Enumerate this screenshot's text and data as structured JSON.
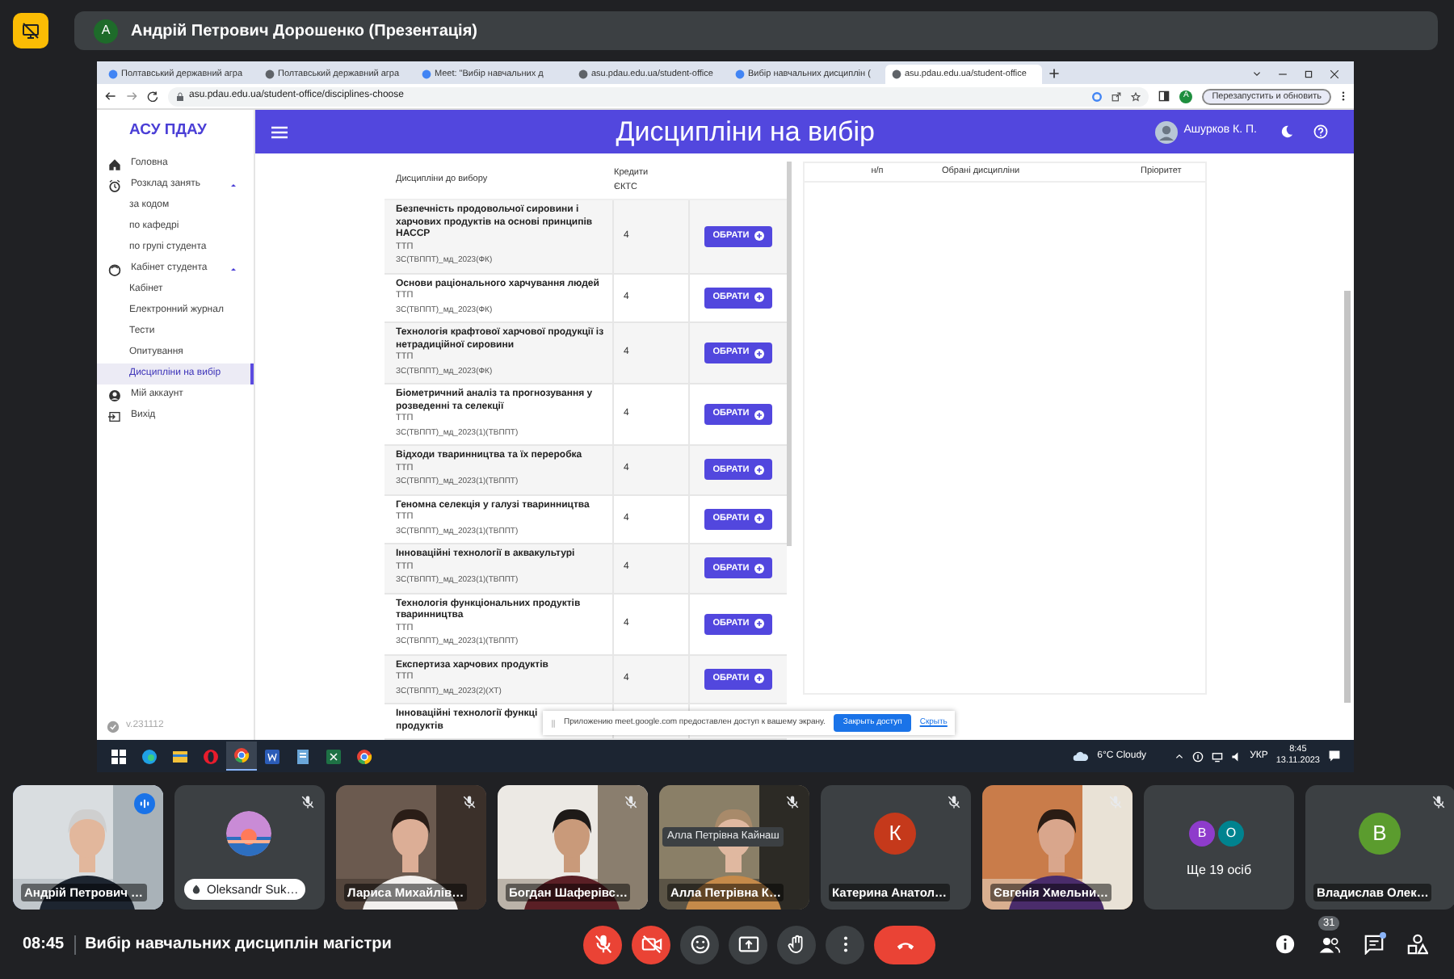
{
  "presenter_bar": {
    "avatar_letter": "A",
    "title": "Андрій Петрович Дорошенко (Презентація)"
  },
  "browser": {
    "tabs": [
      {
        "title": "Полтавський державний агра",
        "selected": false
      },
      {
        "title": "Полтавський державний агра",
        "selected": false
      },
      {
        "title": "Meet: \"Вибір навчальних д",
        "selected": false
      },
      {
        "title": "asu.pdau.edu.ua/student-office",
        "selected": false
      },
      {
        "title": "Вибір навчальних дисциплін (",
        "selected": false
      },
      {
        "title": "asu.pdau.edu.ua/student-office",
        "selected": true
      }
    ],
    "address": "asu.pdau.edu.ua/student-office/disciplines-choose",
    "profile_letter": "A",
    "relaunch_button": "Перезапустить и обновить"
  },
  "app": {
    "logo": "АСУ ПДАУ",
    "header_title": "Дисципліни на вибір",
    "user_name": "Ашурков К. П.",
    "sidebar": {
      "items": [
        {
          "label": "Головна",
          "selected": false
        },
        {
          "label": "Розклад занять",
          "selected": false,
          "expanded": true,
          "children": [
            {
              "label": "за кодом",
              "selected": false
            },
            {
              "label": "по кафедрі",
              "selected": false
            },
            {
              "label": "по групі студента",
              "selected": false
            }
          ]
        },
        {
          "label": "Кабінет студента",
          "selected": false,
          "expanded": true,
          "children": [
            {
              "label": "Кабінет",
              "selected": false
            },
            {
              "label": "Електронний журнал",
              "selected": false
            },
            {
              "label": "Тести",
              "selected": false
            },
            {
              "label": "Опитування",
              "selected": false
            },
            {
              "label": "Дисципліни на вибір",
              "selected": true
            }
          ]
        },
        {
          "label": "Мій аккаунт",
          "selected": false
        },
        {
          "label": "Вихід",
          "selected": false
        }
      ]
    },
    "version": "v.231112",
    "available_table": {
      "columns": [
        "Дисципліни до вибору",
        "Кредити ЄКТС"
      ],
      "rows": [
        {
          "title_lines": [
            "Безпечність продовольчої сировини і",
            "харчових продуктів на основі принципів",
            "НАССР"
          ],
          "department": "ТТП",
          "group": "ЗС(ТВППТ)_мд_2023(ФК)",
          "credits": "4",
          "button": "ОБРАТИ"
        },
        {
          "title_lines": [
            "Основи раціонального харчування людей"
          ],
          "department": "ТТП",
          "group": "ЗС(ТВППТ)_мд_2023(ФК)",
          "credits": "4",
          "button": "ОБРАТИ"
        },
        {
          "title_lines": [
            "Технологія крафтової харчової продукції із",
            "нетрадиційної сировини"
          ],
          "department": "ТТП",
          "group": "ЗС(ТВППТ)_мд_2023(ФК)",
          "credits": "4",
          "button": "ОБРАТИ"
        },
        {
          "title_lines": [
            "Біометричний аналіз та прогнозування у",
            "розведенні та селекції"
          ],
          "department": "ТТП",
          "group": "ЗС(ТВППТ)_мд_2023(1)(ТВППТ)",
          "credits": "4",
          "button": "ОБРАТИ"
        },
        {
          "title_lines": [
            "Відходи тваринництва та їх переробка"
          ],
          "department": "ТТП",
          "group": "ЗС(ТВППТ)_мд_2023(1)(ТВППТ)",
          "credits": "4",
          "button": "ОБРАТИ"
        },
        {
          "title_lines": [
            "Геномна селекція у галузі тваринництва"
          ],
          "department": "ТТП",
          "group": "ЗС(ТВППТ)_мд_2023(1)(ТВППТ)",
          "credits": "4",
          "button": "ОБРАТИ"
        },
        {
          "title_lines": [
            "Інноваційні технології в аквакультурі"
          ],
          "department": "ТТП",
          "group": "ЗС(ТВППТ)_мд_2023(1)(ТВППТ)",
          "credits": "4",
          "button": "ОБРАТИ"
        },
        {
          "title_lines": [
            "Технологія функціональних продуктів",
            "тваринництва"
          ],
          "department": "ТТП",
          "group": "ЗС(ТВППТ)_мд_2023(1)(ТВППТ)",
          "credits": "4",
          "button": "ОБРАТИ"
        },
        {
          "title_lines": [
            "Експертиза харчових продуктів"
          ],
          "department": "ТТП",
          "group": "ЗС(ТВППТ)_мд_2023(2)(ХТ)",
          "credits": "4",
          "button": "ОБРАТИ"
        },
        {
          "title_lines": [
            "Інноваційні технології функці",
            "продуктів"
          ]
        }
      ]
    },
    "chosen_table": {
      "columns": [
        "н/п",
        "Обрані дисципліни",
        "Пріоритет"
      ]
    },
    "share_notice": {
      "text": "Приложению meet.google.com предоставлен доступ к вашему экрану.",
      "stop_button": "Закрыть доступ",
      "hide_link": "Скрыть"
    }
  },
  "taskbar": {
    "apps": [
      {
        "kind": "start",
        "selected": false
      },
      {
        "kind": "edge",
        "selected": false
      },
      {
        "kind": "files",
        "selected": false
      },
      {
        "kind": "opera",
        "selected": false
      },
      {
        "kind": "chrome",
        "selected": true
      },
      {
        "kind": "word",
        "selected": false
      },
      {
        "kind": "tool",
        "selected": false
      },
      {
        "kind": "excel",
        "selected": false
      },
      {
        "kind": "chrome",
        "selected": false
      }
    ],
    "weather": "6°C Cloudy",
    "language": "УКР",
    "time": "8:45",
    "date": "13.11.2023"
  },
  "tiles": [
    {
      "kind": "video",
      "name": "Андрій Петрович …",
      "muted": false,
      "speaking": true
    },
    {
      "kind": "photo_avatar",
      "name": "Oleksandr Suk…",
      "muted": true,
      "speaking": false
    },
    {
      "kind": "video",
      "name": "Лариса Михайлів…",
      "muted": true,
      "speaking": false
    },
    {
      "kind": "video",
      "name": "Богдан Шаферівс…",
      "muted": true,
      "speaking": false
    },
    {
      "kind": "video",
      "name": "Алла Петрівна К…",
      "muted": true,
      "speaking": false,
      "tooltip": "Алла Петрівна Кайнаш"
    },
    {
      "kind": "letter_avatar",
      "name": "Катерина Анатол…",
      "muted": true,
      "speaking": false,
      "letter": "К",
      "color": "#c5391b"
    },
    {
      "kind": "video",
      "name": "Євгенія Хмельни…",
      "muted": true,
      "speaking": false
    },
    {
      "kind": "more",
      "label": "Ще 19 осіб",
      "avatars": [
        {
          "letter": "В",
          "color": "#8e3ccb"
        },
        {
          "letter": "О",
          "color": "#00838f"
        }
      ]
    },
    {
      "kind": "letter_avatar",
      "name": "Владислав Олек…",
      "muted": true,
      "speaking": false,
      "letter": "В",
      "color": "#5b9c2e"
    }
  ],
  "meeting_bar": {
    "time": "08:45",
    "title": "Вибір навчальних дисциплін магістри",
    "controls": [
      {
        "kind": "mic",
        "on": false
      },
      {
        "kind": "camera",
        "on": false
      },
      {
        "kind": "emoji"
      },
      {
        "kind": "present"
      },
      {
        "kind": "hand"
      },
      {
        "kind": "more"
      },
      {
        "kind": "hangup"
      }
    ],
    "participants_count": "31",
    "chat_unread": true
  }
}
